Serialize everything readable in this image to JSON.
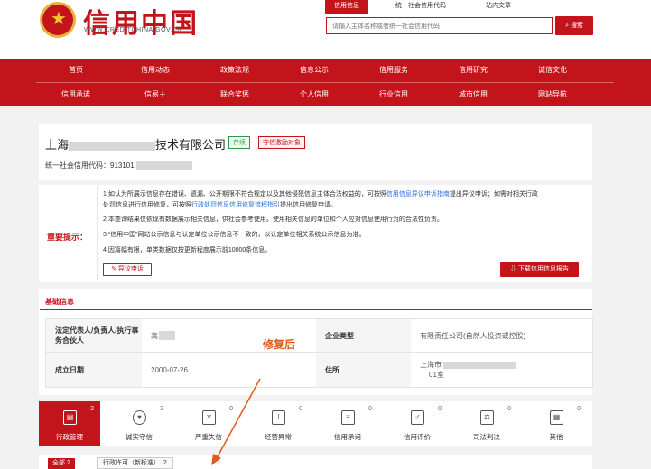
{
  "header": {
    "logo_text": "信用中国",
    "logo_url": "WWW.CREDITCHINA.GOV.CN",
    "search_tabs": [
      "信用信息",
      "统一社会信用代码",
      "站内文章"
    ],
    "search_placeholder": "请输入主体名称或者统一社会信用代码",
    "search_button": "搜索"
  },
  "nav": {
    "row1": [
      "首页",
      "信用动态",
      "政策法规",
      "信息公示",
      "信用服务",
      "信用研究",
      "诚信文化"
    ],
    "row2": [
      "信用承诺",
      "信易＋",
      "联合奖惩",
      "个人信用",
      "行业信用",
      "城市信用",
      "网站导航"
    ]
  },
  "company": {
    "name_prefix": "上海",
    "name_suffix": "技术有限公司",
    "tag_status": "存续",
    "tag_incentive": "守信激励对象",
    "code_label": "统一社会信用代码：",
    "code_value": "913101"
  },
  "notice": {
    "label": "重要提示：",
    "line1a": "1.如认为所展示信息存在错误、遗漏、公开期限不符合规定以及其他侵犯信息主体合法权益的，可按照",
    "line1_link": "信用信息异议申诉指南",
    "line1b": "提出异议申诉；如需对相关行政",
    "line1c": "处罚信息进行信用修复，可按照",
    "line1_link2": "行政处罚信息信用修复流程指引",
    "line1d": "提出信用修复申请。",
    "line2": "2.本查询结果仅依现有数据展示相关信息，供社会参考使用。使用相关信息的单位和个人应对信息使用行为的合法性负责。",
    "line3": "3.“信用中国”网站公示信息与认定单位公示信息不一致的，以认定单位相关系统公示信息为准。",
    "line4": "4.因篇幅有限，单类数据仅按更新程度展示前10000条信息。",
    "appeal_button": "异议申诉",
    "download_button": "下载信用信息报告"
  },
  "basic_info": {
    "title": "基础信息",
    "legal_rep_label": "法定代表人/负责人/执行事务合伙人",
    "legal_rep_value": "高",
    "company_type_label": "企业类型",
    "company_type_value": "有限责任公司(自然人投资或控股)",
    "established_label": "成立日期",
    "established_value": "2000-07-26",
    "address_label": "住所",
    "address_value_a": "上海市",
    "address_value_b": "01室"
  },
  "annotation": {
    "text": "修复后",
    "color": "#e05a1c"
  },
  "categories": [
    {
      "label": "行政管理",
      "count": "2",
      "icon": "admin-icon"
    },
    {
      "label": "诚实守信",
      "count": "2",
      "icon": "trust-icon"
    },
    {
      "label": "严重失信",
      "count": "0",
      "icon": "serious-icon"
    },
    {
      "label": "经营异常",
      "count": "0",
      "icon": "abnormal-icon"
    },
    {
      "label": "信用承诺",
      "count": "0",
      "icon": "promise-icon"
    },
    {
      "label": "信用评价",
      "count": "0",
      "icon": "evaluation-icon"
    },
    {
      "label": "司法判决",
      "count": "0",
      "icon": "judgment-icon"
    },
    {
      "label": "其他",
      "count": "0",
      "icon": "other-icon"
    }
  ],
  "filter": {
    "all_label": "全部",
    "all_count": "2",
    "chip_label": "行政许可（新标准）",
    "chip_count": "2"
  },
  "colors": {
    "brand": "#c4141b",
    "link": "#2a6ed2",
    "status_green": "#2e9a4a"
  }
}
